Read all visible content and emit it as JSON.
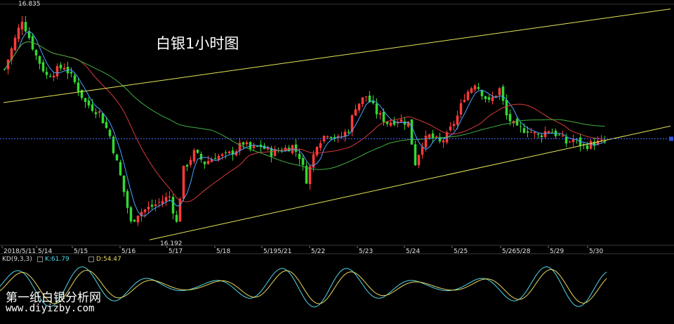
{
  "title": "白银1小时图",
  "watermark": {
    "line1": "第一纸白银分析网",
    "line2": "www.diyizby.com"
  },
  "indicator": {
    "name": "KD(9,3,3)",
    "k_label": "K:61.79",
    "d_label": "D:54.47"
  },
  "colors": {
    "background": "#000000",
    "up_candle": "#ff3b3b",
    "down_candle": "#33d833",
    "ma_short": "#4aa3ff",
    "ma_mid": "#d83a3a",
    "ma_long": "#3fae3f",
    "channel": "#e6e65a",
    "k_line": "#52d8e8",
    "d_line": "#e8d85a",
    "price_line": "#4a66ff",
    "grid": "#2c2c2c"
  },
  "chart_data": {
    "type": "candlestick",
    "title": "白银1小时图",
    "x_date_labels": [
      "2018/5/11",
      "5/14",
      "5/15",
      "5/16",
      "5/17",
      "5/18",
      "5/195/21",
      "5/22",
      "5/23",
      "5/24",
      "5/25",
      "5/265/28",
      "5/29",
      "5/30"
    ],
    "annotations": {
      "high": "16.835",
      "low": "16.192"
    },
    "price_range": [
      16.16,
      16.87
    ],
    "current_price": 16.472,
    "close_path": [
      [
        0,
        16.68
      ],
      [
        5,
        16.83
      ],
      [
        9,
        16.72
      ],
      [
        12,
        16.66
      ],
      [
        17,
        16.69
      ],
      [
        20,
        16.64
      ],
      [
        23,
        16.58
      ],
      [
        27,
        16.55
      ],
      [
        30,
        16.48
      ],
      [
        33,
        16.36
      ],
      [
        36,
        16.22
      ],
      [
        38,
        16.25
      ],
      [
        42,
        16.27
      ],
      [
        47,
        16.3
      ],
      [
        49,
        16.22
      ],
      [
        51,
        16.38
      ],
      [
        54,
        16.43
      ],
      [
        57,
        16.4
      ],
      [
        60,
        16.42
      ],
      [
        63,
        16.42
      ],
      [
        66,
        16.44
      ],
      [
        68,
        16.46
      ],
      [
        70,
        16.44
      ],
      [
        73,
        16.45
      ],
      [
        76,
        16.43
      ],
      [
        79,
        16.44
      ],
      [
        82,
        16.45
      ],
      [
        84,
        16.42
      ],
      [
        86,
        16.35
      ],
      [
        89,
        16.46
      ],
      [
        92,
        16.49
      ],
      [
        95,
        16.47
      ],
      [
        98,
        16.5
      ],
      [
        100,
        16.57
      ],
      [
        103,
        16.6
      ],
      [
        106,
        16.55
      ],
      [
        109,
        16.52
      ],
      [
        112,
        16.53
      ],
      [
        115,
        16.52
      ],
      [
        117,
        16.4
      ],
      [
        119,
        16.46
      ],
      [
        121,
        16.48
      ],
      [
        124,
        16.46
      ],
      [
        126,
        16.48
      ],
      [
        129,
        16.54
      ],
      [
        131,
        16.6
      ],
      [
        134,
        16.64
      ],
      [
        136,
        16.61
      ],
      [
        138,
        16.58
      ],
      [
        141,
        16.62
      ],
      [
        143,
        16.54
      ],
      [
        146,
        16.5
      ],
      [
        149,
        16.5
      ],
      [
        152,
        16.48
      ],
      [
        155,
        16.5
      ],
      [
        158,
        16.48
      ],
      [
        160,
        16.46
      ],
      [
        162,
        16.47
      ],
      [
        165,
        16.45
      ],
      [
        168,
        16.46
      ]
    ],
    "series": [
      {
        "name": "",
        "kind": "moving_average",
        "values": []
      },
      {
        "name": "",
        "kind": "moving_average",
        "values": []
      },
      {
        "name": "",
        "kind": "moving_average",
        "values": []
      }
    ],
    "kd": {
      "k": 61.79,
      "d": 54.47
    }
  }
}
